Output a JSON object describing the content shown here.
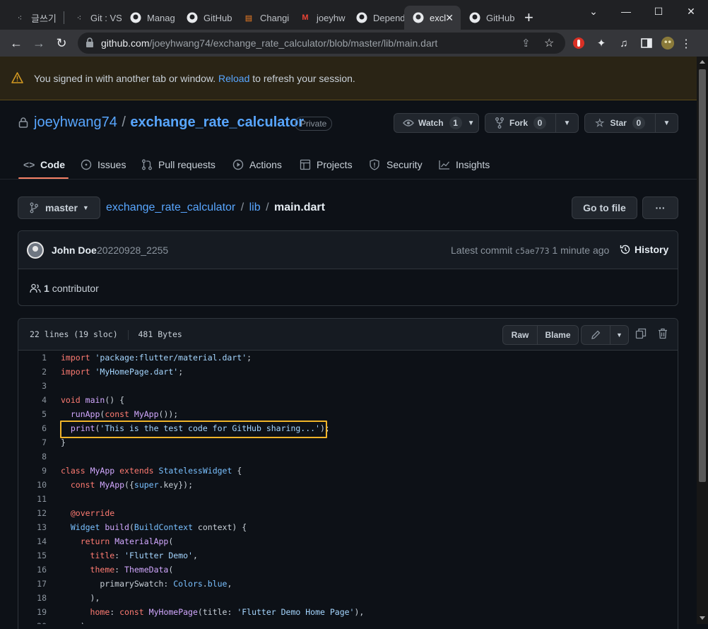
{
  "browser": {
    "tabs": [
      {
        "label": "글쓰기",
        "icon": "tistory-icon"
      },
      {
        "label": "Git : VS",
        "icon": "tistory-icon"
      },
      {
        "label": "Manag",
        "icon": "github-icon"
      },
      {
        "label": "GitHub",
        "icon": "github-icon"
      },
      {
        "label": "Changi",
        "icon": "stackoverflow-icon"
      },
      {
        "label": "joeyhw",
        "icon": "gmail-icon"
      },
      {
        "label": "Depend",
        "icon": "github-icon"
      },
      {
        "label": "excl",
        "icon": "github-icon"
      },
      {
        "label": "GitHub",
        "icon": "github-icon"
      }
    ],
    "new_tab": "+",
    "url_host": "github.com",
    "url_path": "/joeyhwang74/exchange_rate_calculator/blob/master/lib/main.dart"
  },
  "banner": {
    "text_before": "You signed in with another tab or window.",
    "link": "Reload",
    "text_after": "to refresh your session."
  },
  "repo": {
    "owner": "joeyhwang74",
    "separator": "/",
    "name": "exchange_rate_calculator",
    "visibility": "Private",
    "watch_label": "Watch",
    "watch_count": "1",
    "fork_label": "Fork",
    "fork_count": "0",
    "star_label": "Star",
    "star_count": "0"
  },
  "repo_tabs": [
    "Code",
    "Issues",
    "Pull requests",
    "Actions",
    "Projects",
    "Security",
    "Insights"
  ],
  "file_nav": {
    "branch": "master",
    "path_repo": "exchange_rate_calculator",
    "path_dir": "lib",
    "file": "main.dart",
    "go_to_file": "Go to file",
    "more": "···"
  },
  "commit": {
    "author": "John Doe",
    "message": "20220928_2255",
    "latest_label": "Latest commit",
    "sha": "c5ae773",
    "time": "1 minute ago",
    "history": "History",
    "contributors_count": "1",
    "contributors_label": "contributor"
  },
  "file_info": {
    "lines": "22 lines (19 sloc)",
    "size": "481 Bytes",
    "raw": "Raw",
    "blame": "Blame"
  },
  "code_lines": [
    "import 'package:flutter/material.dart';",
    "import 'MyHomePage.dart';",
    "",
    "void main() {",
    "  runApp(const MyApp());",
    "  print('This is the test code for GitHub sharing...');",
    "}",
    "",
    "class MyApp extends StatelessWidget {",
    "  const MyApp({super.key});",
    "",
    "  @override",
    "  Widget build(BuildContext context) {",
    "    return MaterialApp(",
    "      title: 'Flutter Demo',",
    "      theme: ThemeData(",
    "        primarySwatch: Colors.blue,",
    "      ),",
    "      home: const MyHomePage(title: 'Flutter Demo Home Page'),",
    "    );"
  ],
  "colors": {
    "highlight_box": "#f0b429",
    "link": "#58a6ff",
    "tab_underline": "#f78166"
  }
}
